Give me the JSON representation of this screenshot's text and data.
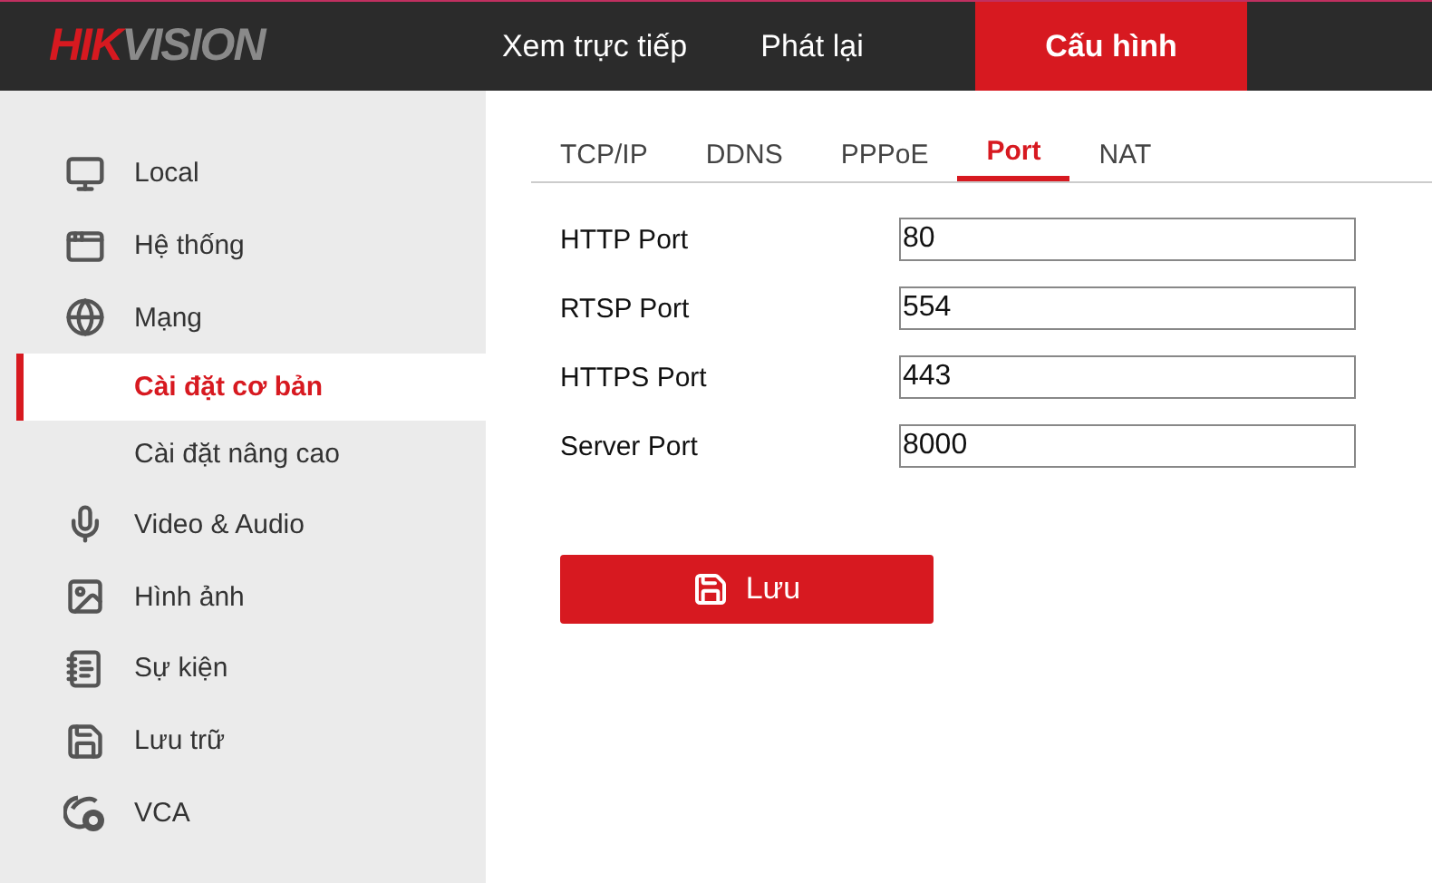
{
  "header": {
    "logo": {
      "accent": "HIK",
      "rest": "VISION"
    },
    "nav": [
      {
        "label": "Xem trực tiếp",
        "selected": false
      },
      {
        "label": "Phát lại",
        "selected": false
      },
      {
        "label": "Cấu hình",
        "selected": true
      }
    ]
  },
  "sidebar": {
    "items": [
      {
        "label": "Local",
        "kind": "monitor"
      },
      {
        "label": "Hệ thống",
        "kind": "window"
      },
      {
        "label": "Mạng",
        "kind": "globe",
        "children": [
          {
            "label": "Cài đặt cơ bản",
            "selected": true
          },
          {
            "label": "Cài đặt nâng cao",
            "selected": false
          }
        ]
      },
      {
        "label": "Video & Audio",
        "kind": "mic"
      },
      {
        "label": "Hình ảnh",
        "kind": "image"
      },
      {
        "label": "Sự kiện",
        "kind": "notes"
      },
      {
        "label": "Lưu trữ",
        "kind": "disk"
      },
      {
        "label": "VCA",
        "kind": "vca"
      }
    ]
  },
  "tabs": [
    {
      "label": "TCP/IP",
      "selected": false
    },
    {
      "label": "DDNS",
      "selected": false
    },
    {
      "label": "PPPoE",
      "selected": false
    },
    {
      "label": "Port",
      "selected": true
    },
    {
      "label": "NAT",
      "selected": false
    }
  ],
  "fields": [
    {
      "label": "HTTP Port",
      "value": "80"
    },
    {
      "label": "RTSP Port",
      "value": "554"
    },
    {
      "label": "HTTPS Port",
      "value": "443"
    },
    {
      "label": "Server Port",
      "value": "8000"
    }
  ],
  "save_button": {
    "label": "Lưu"
  }
}
